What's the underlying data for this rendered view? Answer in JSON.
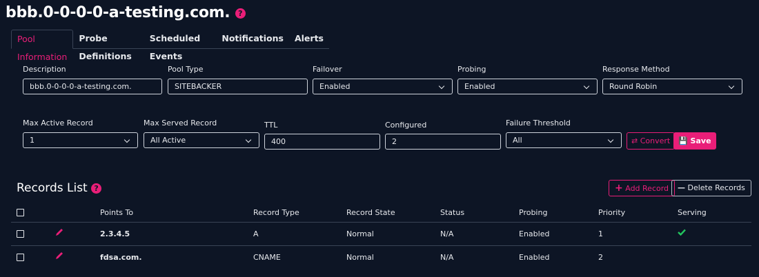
{
  "page": {
    "title": "bbb.0-0-0-0-a-testing.com."
  },
  "colors": {
    "background": "#0d1525",
    "accent": "#e91e78",
    "success": "#22c55e"
  },
  "tabs": [
    {
      "label": "Pool Information",
      "active": true
    },
    {
      "label": "Probe Definitions",
      "active": false
    },
    {
      "label": "Scheduled Events",
      "active": false
    },
    {
      "label": "Notifications",
      "active": false
    },
    {
      "label": "Alerts",
      "active": false
    }
  ],
  "form": {
    "description": {
      "label": "Description",
      "value": "bbb.0-0-0-0-a-testing.com."
    },
    "pool_type": {
      "label": "Pool Type",
      "value": "SITEBACKER"
    },
    "failover": {
      "label": "Failover",
      "value": "Enabled"
    },
    "probing": {
      "label": "Probing",
      "value": "Enabled"
    },
    "response_method": {
      "label": "Response Method",
      "value": "Round Robin"
    },
    "max_active_record": {
      "label": "Max Active Record",
      "value": "1"
    },
    "max_served_record": {
      "label": "Max Served Record",
      "value": "All Active"
    },
    "ttl": {
      "label": "TTL",
      "value": "400"
    },
    "configured": {
      "label": "Configured",
      "value": "2"
    },
    "failure_threshold": {
      "label": "Failure Threshold",
      "value": "All"
    },
    "convert_label": "Convert",
    "save_label": "Save"
  },
  "records": {
    "title": "Records List",
    "add_label": "Add Record",
    "delete_label": "Delete Records",
    "columns": [
      "Points To",
      "Record Type",
      "Record State",
      "Status",
      "Probing",
      "Priority",
      "Serving"
    ],
    "rows": [
      {
        "points_to": "2.3.4.5",
        "record_type": "A",
        "record_state": "Normal",
        "status": "N/A",
        "probing": "Enabled",
        "priority": "1",
        "serving": true
      },
      {
        "points_to": "fdsa.com.",
        "record_type": "CNAME",
        "record_state": "Normal",
        "status": "N/A",
        "probing": "Enabled",
        "priority": "2",
        "serving": false
      }
    ]
  }
}
